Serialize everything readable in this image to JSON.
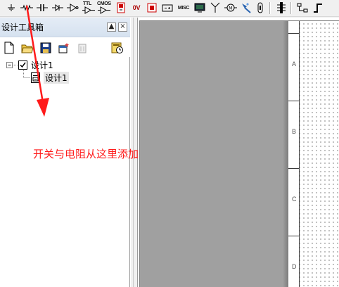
{
  "toolbar": {
    "items": [
      {
        "icon": "ground-symbol-icon"
      },
      {
        "icon": "resistor-icon"
      },
      {
        "icon": "capacitor-icon"
      },
      {
        "icon": "diode-icon"
      },
      {
        "icon": "buffer-gate-icon"
      },
      {
        "icon": "ttl-chip-icon",
        "text": "TTL"
      },
      {
        "icon": "cmos-chip-icon",
        "text": "CMOS"
      },
      {
        "icon": "meter-icon"
      },
      {
        "icon": "voltmeter-icon",
        "text": "0V"
      },
      {
        "icon": "indicator-icon"
      },
      {
        "icon": "battery-icon"
      },
      {
        "icon": "misc-icon",
        "text": "MISC"
      },
      {
        "icon": "display-icon"
      },
      {
        "icon": "antenna-icon"
      },
      {
        "icon": "motor-icon"
      },
      {
        "icon": "wizard-icon"
      },
      {
        "icon": "fuse-icon"
      },
      {
        "icon": "bus-icon"
      },
      {
        "icon": "hierarchy-icon"
      },
      {
        "icon": "step-signal-icon"
      }
    ]
  },
  "toolbox": {
    "title": "设计工具箱",
    "pin_label": "▲",
    "close_label": "×",
    "icons": [
      "new-design-icon",
      "open-folder-icon",
      "save-icon",
      "new-sheet-icon",
      "delete-icon",
      "properties-icon"
    ]
  },
  "tree": {
    "root_label": "设计1",
    "child_label": "设计1"
  },
  "sheet": {
    "zones": [
      "A",
      "B",
      "C",
      "D"
    ]
  },
  "annotation": {
    "text": "开关与电阻从这里添加",
    "color": "#ff1a1a"
  }
}
